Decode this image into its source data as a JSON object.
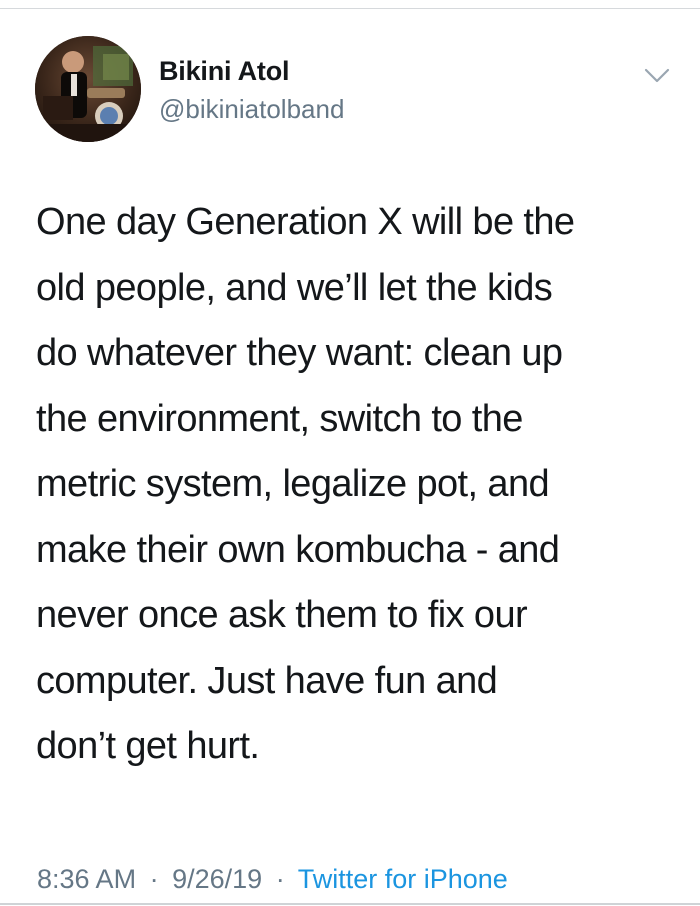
{
  "user": {
    "display_name": "Bikini Atol",
    "handle": "@bikiniatolband",
    "avatar_icon": "profile-photo"
  },
  "tweet": {
    "text": "One day Generation X will be the\nold people, and we’ll let the kids\ndo whatever they want: clean up\nthe environment, switch to the\nmetric system, legalize pot, and\nmake their own kombucha - and\nnever once ask them to fix our\ncomputer. Just have fun and\ndon’t get hurt."
  },
  "meta": {
    "time": "8:36 AM",
    "separator": "·",
    "date": "9/26/19",
    "source": "Twitter for iPhone"
  },
  "menu": {
    "icon": "chevron-down-icon"
  },
  "colors": {
    "text": "#14171a",
    "muted": "#657786",
    "link": "#1b95e0",
    "border": "#d6d9dc"
  }
}
